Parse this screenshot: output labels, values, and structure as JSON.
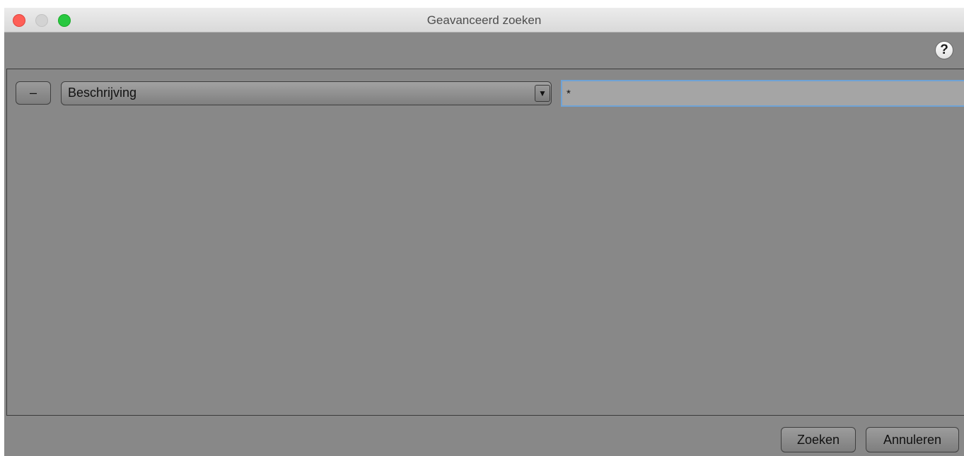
{
  "window": {
    "title": "Geavanceerd zoeken"
  },
  "toolbar": {
    "help_label": "?"
  },
  "criteria": [
    {
      "remove_label": "–",
      "field": "Beschrijving",
      "dropdown_arrow": "▼",
      "value": "*"
    }
  ],
  "buttons": {
    "search_label": "Zoeken",
    "cancel_label": "Annuleren"
  },
  "colors": {
    "window_bg": "#888888",
    "focus_ring": "#6fa3d6",
    "close": "#fe5f57",
    "minimize_inactive": "#d3d3d3",
    "maximize": "#28c840"
  }
}
